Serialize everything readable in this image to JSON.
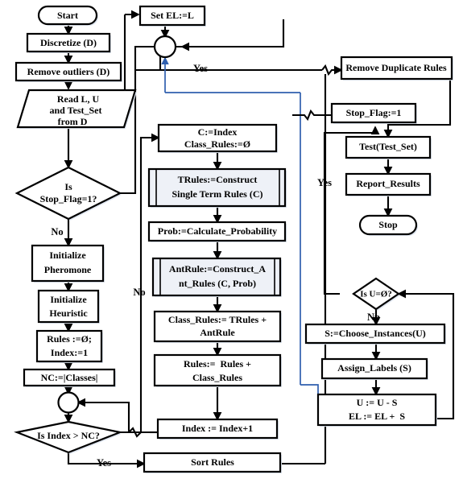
{
  "diagram": {
    "title": "Self-training Ant-Miner Classification Flowchart",
    "colors": {
      "stroke": "#000000",
      "blue_edge": "#2f5fae",
      "node_fill": "#ffffff",
      "shaded_fill": "#eef1f7",
      "shadow": "#dfe6f0",
      "background": "#ffffff"
    },
    "nodes": [
      {
        "id": "start",
        "type": "terminator",
        "label": "Start"
      },
      {
        "id": "discretize",
        "type": "process",
        "label": "Discretize (D)"
      },
      {
        "id": "remove_outliers",
        "type": "process",
        "label": "Remove outliers (D)"
      },
      {
        "id": "read_data",
        "type": "io",
        "label_lines": [
          "Read L, U",
          "and Test_Set",
          "from D"
        ]
      },
      {
        "id": "set_el",
        "type": "process",
        "label": "Set EL:=L"
      },
      {
        "id": "merge_top",
        "type": "connector",
        "label": ""
      },
      {
        "id": "is_stop_flag",
        "type": "decision",
        "label_lines": [
          "Is",
          "Stop_Flag=1?"
        ]
      },
      {
        "id": "init_pheromone",
        "type": "process",
        "label_lines": [
          "Initialize",
          "Pheromone"
        ]
      },
      {
        "id": "init_heuristic",
        "type": "process",
        "label_lines": [
          "Initialize",
          "Heuristic"
        ]
      },
      {
        "id": "rules_index",
        "type": "process",
        "label_lines": [
          "Rules :=Ø;",
          "Index:=1"
        ]
      },
      {
        "id": "nc_classes",
        "type": "process",
        "label": "NC:=|Classes|"
      },
      {
        "id": "merge_loop",
        "type": "connector",
        "label": ""
      },
      {
        "id": "is_index_gt_nc",
        "type": "decision",
        "label": "Is Index > NC?"
      },
      {
        "id": "c_index",
        "type": "process",
        "label_lines": [
          "C:=Index",
          "Class_Rules:=Ø"
        ]
      },
      {
        "id": "trules",
        "type": "subroutine",
        "label_lines": [
          "TRules:=Construct",
          "Single Term Rules (C)"
        ]
      },
      {
        "id": "prob",
        "type": "process",
        "label": "Prob:=Calculate_Probability"
      },
      {
        "id": "antrule",
        "type": "subroutine",
        "label_lines": [
          "AntRule:=Construct_A",
          "nt_Rules (C, Prob)"
        ]
      },
      {
        "id": "class_rules_sum",
        "type": "process",
        "label_lines": [
          "Class_Rules:= TRules +",
          "AntRule"
        ]
      },
      {
        "id": "rules_sum",
        "type": "process",
        "label_lines": [
          "Rules:=  Rules +",
          "Class_Rules"
        ]
      },
      {
        "id": "index_inc",
        "type": "process",
        "label": "Index := Index+1"
      },
      {
        "id": "sort_rules",
        "type": "process",
        "label": "Sort Rules"
      },
      {
        "id": "remove_dup",
        "type": "process",
        "label": "Remove Duplicate Rules"
      },
      {
        "id": "stop_flag_set",
        "type": "process",
        "label": "Stop_Flag:=1"
      },
      {
        "id": "test_testset",
        "type": "process",
        "label": "Test(Test_Set)"
      },
      {
        "id": "report_results",
        "type": "process",
        "label": "Report_Results"
      },
      {
        "id": "stop",
        "type": "terminator",
        "label": "Stop"
      },
      {
        "id": "is_u_empty",
        "type": "decision",
        "label": "Is U=Ø?"
      },
      {
        "id": "choose_instances",
        "type": "process",
        "label": "S:=Choose_Instances(U)"
      },
      {
        "id": "assign_labels",
        "type": "process",
        "label": "Assign_Labels (S)"
      },
      {
        "id": "update_sets",
        "type": "process",
        "label_lines": [
          "U := U - S",
          "EL := EL +  S"
        ]
      }
    ],
    "edge_labels": [
      {
        "id": "yes_stop_flag",
        "text": "Yes"
      },
      {
        "id": "no_stop_flag",
        "text": "No"
      },
      {
        "id": "no_index",
        "text": "No"
      },
      {
        "id": "yes_index",
        "text": "Yes"
      },
      {
        "id": "yes_u_empty",
        "text": "Yes"
      },
      {
        "id": "no_u_empty",
        "text": "Np"
      }
    ]
  }
}
